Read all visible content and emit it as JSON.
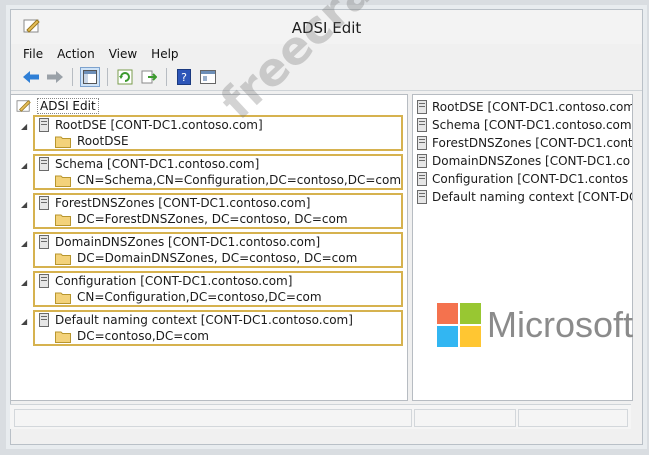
{
  "window": {
    "title": "ADSI Edit"
  },
  "menu": [
    "File",
    "Action",
    "View",
    "Help"
  ],
  "toolbar_icons": [
    "back-arrow-icon",
    "forward-arrow-icon",
    "console-tree-icon",
    "refresh-icon",
    "export-list-icon",
    "help-icon",
    "properties-icon"
  ],
  "tree": {
    "root_label": "ADSI Edit",
    "nodes": [
      {
        "label": "RootDSE [CONT-DC1.contoso.com]",
        "child": "RootDSE"
      },
      {
        "label": "Schema [CONT-DC1.contoso.com]",
        "child": "CN=Schema,CN=Configuration,DC=contoso,DC=com"
      },
      {
        "label": "ForestDNSZones [CONT-DC1.contoso.com]",
        "child": "DC=ForestDNSZones, DC=contoso, DC=com"
      },
      {
        "label": "DomainDNSZones [CONT-DC1.contoso.com]",
        "child": "DC=DomainDNSZones, DC=contoso, DC=com"
      },
      {
        "label": "Configuration [CONT-DC1.contoso.com]",
        "child": "CN=Configuration,DC=contoso,DC=com"
      },
      {
        "label": "Default naming context [CONT-DC1.contoso.com]",
        "child": "DC=contoso,DC=com"
      }
    ]
  },
  "right_list": [
    "RootDSE [CONT-DC1.contoso.com",
    "Schema [CONT-DC1.contoso.com",
    "ForestDNSZones [CONT-DC1.conto",
    "DomainDNSZones [CONT-DC1.co",
    "Configuration [CONT-DC1.contos",
    "Default naming context [CONT-DC"
  ],
  "watermark": "freecram.net",
  "logo": {
    "word": "Microsoft",
    "colors": [
      "#f25022",
      "#7fba00",
      "#00a4ef",
      "#ffb900"
    ]
  }
}
